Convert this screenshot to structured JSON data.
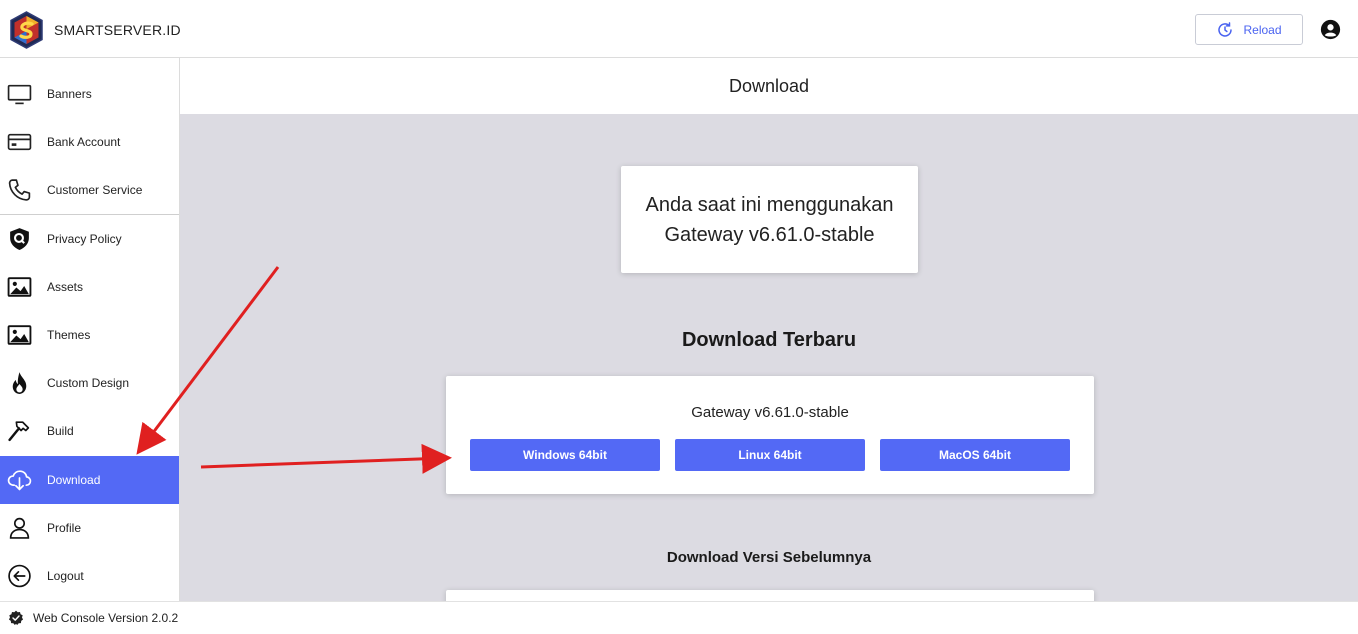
{
  "header": {
    "brand": "SMARTSERVER.ID",
    "reload_label": "Reload"
  },
  "sidebar": {
    "items": [
      {
        "label": "Banners",
        "icon": "monitor-icon"
      },
      {
        "label": "Bank Account",
        "icon": "credit-card-icon"
      },
      {
        "label": "Customer Service",
        "icon": "phone-icon"
      },
      {
        "label": "Privacy Policy",
        "icon": "shield-icon"
      },
      {
        "label": "Assets",
        "icon": "image-icon"
      },
      {
        "label": "Themes",
        "icon": "image-icon"
      },
      {
        "label": "Custom Design",
        "icon": "flame-icon"
      },
      {
        "label": "Build",
        "icon": "hammer-icon"
      },
      {
        "label": "Download",
        "icon": "cloud-download-icon",
        "active": true
      },
      {
        "label": "Profile",
        "icon": "user-icon"
      },
      {
        "label": "Logout",
        "icon": "arrow-left-circle-icon"
      }
    ]
  },
  "main": {
    "page_title": "Download",
    "current_line1": "Anda saat ini menggunakan",
    "current_line2": "Gateway v6.61.0-stable",
    "latest_title": "Download Terbaru",
    "latest_version": "Gateway v6.61.0-stable",
    "buttons": {
      "windows": "Windows 64bit",
      "linux": "Linux 64bit",
      "macos": "MacOS 64bit"
    },
    "previous_title": "Download Versi Sebelumnya"
  },
  "footer": {
    "version": "Web Console Version 2.0.2"
  },
  "colors": {
    "accent": "#5369f5",
    "annotation_arrow": "#e02020",
    "content_bg": "#dcdbe2"
  }
}
